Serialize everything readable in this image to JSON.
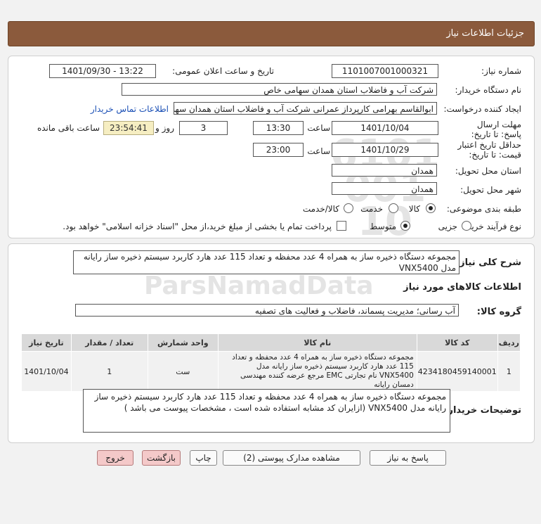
{
  "header": {
    "title": "جزئیات اطلاعات نیاز"
  },
  "fields": {
    "need_number_label": "شماره نیاز:",
    "need_number": "1101007001000321",
    "announce_label": "تاریخ و ساعت اعلان عمومی:",
    "announce_value": "1401/09/30 - 13:22",
    "buyer_org_label": "نام دستگاه خریدار:",
    "buyer_org": "شرکت آب و فاضلاب استان همدان سهامی خاص",
    "requester_label": "ایجاد کننده درخواست:",
    "requester": "ابوالقاسم بهرامی کارپرداز عمرانی شرکت آب و فاضلاب استان همدان سهامی خ",
    "contact_link": "اطلاعات تماس خریدار",
    "reply_deadline_label": "مهلت ارسال پاسخ: تا تاریخ:",
    "reply_date": "1401/10/04",
    "time_label": "ساعت",
    "reply_time": "13:30",
    "days": "3",
    "days_label": "روز و",
    "remaining": "23:54:41",
    "remaining_label": "ساعت باقی مانده",
    "validity_label": "حداقل تاریخ اعتبار قیمت: تا تاریخ:",
    "validity_date": "1401/10/29",
    "validity_time": "23:00",
    "province_label": "استان محل تحویل:",
    "province": "همدان",
    "city_label": "شهر محل تحویل:",
    "city": "همدان",
    "category_label": "طبقه بندی موضوعی:",
    "category_options": [
      "کالا",
      "خدمت",
      "کالا/خدمت"
    ],
    "process_label": "نوع فرآیند خرید :",
    "process_options": [
      "جزیی",
      "متوسط"
    ],
    "payment_note": "پرداخت تمام یا بخشی از مبلغ خرید،از محل \"اسناد خزانه اسلامی\" خواهد بود."
  },
  "summary": {
    "label": "شرح کلی نیاز:",
    "text": "مجموعه دستگاه ذخیره ساز به همراه 4 عدد محفظه و تعداد 115 عدد هارد کاربرد سیستم ذخیره ساز رایانه مدل VNX5400"
  },
  "goods": {
    "section_title": "اطلاعات کالاهای مورد نیاز",
    "group_label": "گروه کالا:",
    "group": "آب رسانی؛ مدیریت پسماند، فاضلاب و فعالیت های تصفیه",
    "columns": [
      "ردیف",
      "کد کالا",
      "نام کالا",
      "واحد شمارش",
      "تعداد / مقدار",
      "تاریخ نیاز"
    ],
    "rows": [
      {
        "row": "1",
        "code": "4234180459140001",
        "name": "مجموعه دستگاه ذخیره ساز به همراه 4 عدد محفظه و تعداد 115 عدد هارد کاربرد سیستم ذخیره ساز رایانه مدل VNX5400 نام تجارتی EMC مرجع عرضه کننده مهندسی دمسان رایانه",
        "unit": "ست",
        "qty": "1",
        "date": "1401/10/04"
      }
    ]
  },
  "buyer_notes": {
    "label": "توضیحات خریدار:",
    "text": "مجموعه دستگاه ذخیره ساز به همراه 4 عدد محفظه و تعداد 115 عدد هارد کاربرد سیستم ذخیره ساز رایانه مدل VNX5400 (ازایران کد مشابه استفاده شده است ، مشخصات پیوست می باشد )"
  },
  "buttons": {
    "reply": "پاسخ به نیاز",
    "attachments": "مشاهده مدارک پیوستی (2)",
    "print": "چاپ",
    "back": "بازگشت",
    "exit": "خروج"
  },
  "watermark": {
    "brand": "ParsNamadData"
  }
}
